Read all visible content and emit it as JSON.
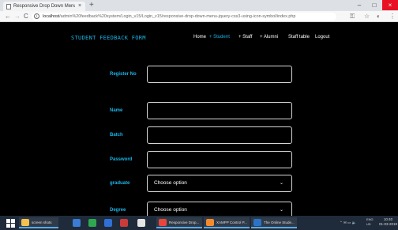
{
  "browser": {
    "tab_title": "Responsive Drop Down Menu | C",
    "tab_close": "×",
    "new_tab": "+",
    "window_controls": {
      "minimize": "–",
      "maximize": "□",
      "close": "×"
    },
    "nav": {
      "back": "←",
      "forward": "→",
      "reload": "C"
    },
    "url_host": "localhost",
    "url_path": "/admin%20feedback%20system/Login_v15/Login_v15/responsive-drop-down-menu-jquery-css3-using-icon-symbol/index.php",
    "icons": [
      "key-icon",
      "star-icon",
      "extension-icon",
      "menu-icon"
    ]
  },
  "page": {
    "brand": "STUDENT FEEDBACK FORM",
    "nav": [
      {
        "label": "Home",
        "prefix": "",
        "active": false
      },
      {
        "label": "Student",
        "prefix": "+",
        "active": true
      },
      {
        "label": "Staff",
        "prefix": "+",
        "active": false
      },
      {
        "label": "Alumni",
        "prefix": "+",
        "active": false
      },
      {
        "label": "Staff table",
        "prefix": "",
        "active": false
      },
      {
        "label": "Logout",
        "prefix": "",
        "active": false
      }
    ],
    "fields": [
      {
        "label": "Register No",
        "value": "",
        "type": "text"
      },
      {
        "label": "Name",
        "value": "",
        "type": "text"
      },
      {
        "label": "Batch",
        "value": "",
        "type": "text"
      },
      {
        "label": "Password",
        "value": "",
        "type": "password"
      },
      {
        "label": "graduate",
        "value": "Choose option",
        "type": "select"
      },
      {
        "label": "Degree",
        "value": "Choose option",
        "type": "select"
      }
    ],
    "accent_color": "#19b5e8"
  },
  "taskbar": {
    "items": [
      {
        "label": "screen shots",
        "color": "#f2c14e"
      },
      {
        "label": "Responsive Drop...",
        "color": "#e8453c"
      },
      {
        "label": "XAMPP Control P...",
        "color": "#f58a2d"
      },
      {
        "label": "The Online Stude...",
        "color": "#2b73c9"
      }
    ],
    "tray_lang": "ENG",
    "tray_region": "US",
    "time": "10:40",
    "date": "01-03-2019"
  }
}
